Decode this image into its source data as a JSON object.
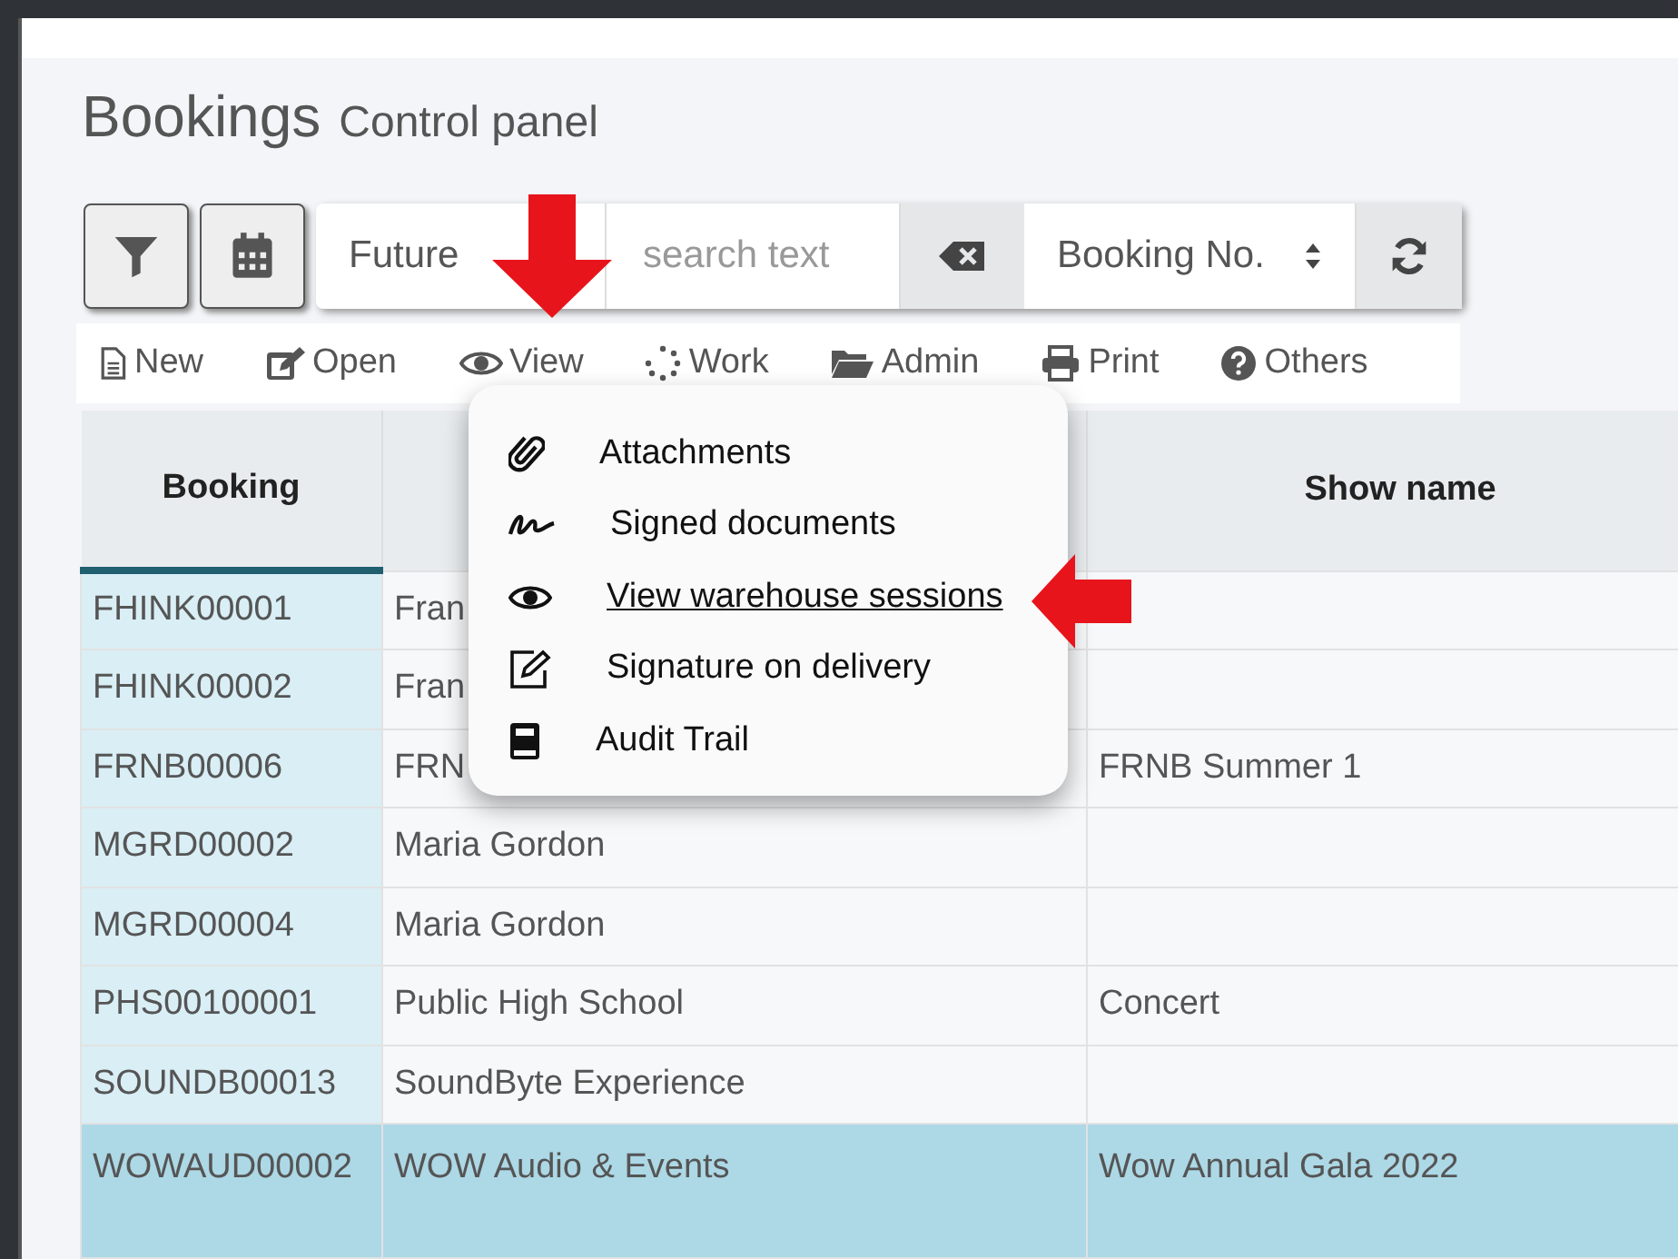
{
  "header": {
    "title": "Bookings",
    "subtitle": "Control panel"
  },
  "toolbar": {
    "period": "Future",
    "search": {
      "placeholder": "search text"
    },
    "sort_by": "Booking No."
  },
  "actions": [
    {
      "label": "New"
    },
    {
      "label": "Open"
    },
    {
      "label": "View"
    },
    {
      "label": "Work"
    },
    {
      "label": "Admin"
    },
    {
      "label": "Print"
    },
    {
      "label": "Others"
    }
  ],
  "view_menu": [
    {
      "label": "Attachments",
      "selected": false
    },
    {
      "label": "Signed documents",
      "selected": false
    },
    {
      "label": "View warehouse sessions",
      "selected": true
    },
    {
      "label": "Signature on delivery",
      "selected": false
    },
    {
      "label": "Audit Trail",
      "selected": false
    }
  ],
  "table": {
    "columns": [
      {
        "label": "Booking",
        "sorted": true
      },
      {
        "sorted": false
      },
      {
        "label": "Show name",
        "sorted": false
      }
    ],
    "rows": [
      {
        "cells": [
          "FHINK00001",
          "Fran",
          ""
        ],
        "selected": false
      },
      {
        "cells": [
          "FHINK00002",
          "Fran",
          ""
        ],
        "selected": false
      },
      {
        "cells": [
          "FRNB00006",
          "FRN",
          "FRNB Summer 1"
        ],
        "selected": false
      },
      {
        "cells": [
          "MGRD00002",
          "Maria Gordon",
          ""
        ],
        "selected": false
      },
      {
        "cells": [
          "MGRD00004",
          "Maria Gordon",
          ""
        ],
        "selected": false
      },
      {
        "cells": [
          "PHS00100001",
          "Public High School",
          "Concert"
        ],
        "selected": false
      },
      {
        "cells": [
          "SOUNDB00013",
          "SoundByte Experience",
          ""
        ],
        "selected": false
      },
      {
        "cells": [
          "WOWAUD00002",
          "WOW Audio & Events",
          "Wow Annual Gala 2022"
        ],
        "selected": true
      }
    ]
  }
}
